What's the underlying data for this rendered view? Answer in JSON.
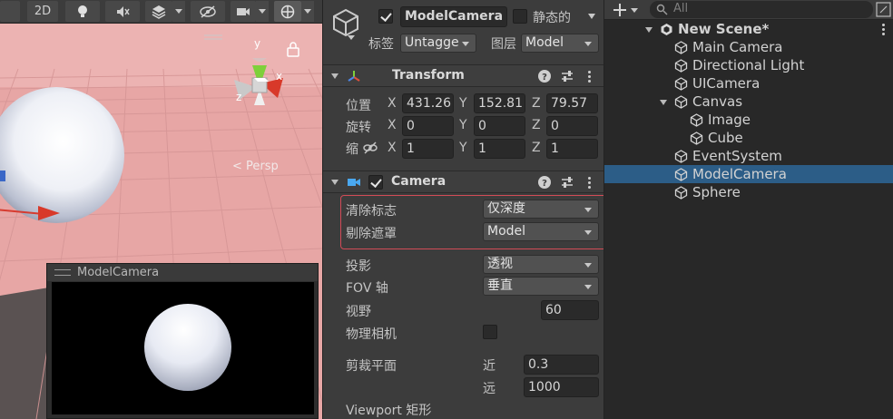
{
  "scene": {
    "toolbar": {
      "mode_2d": "2D"
    },
    "persp_label": "< Persp",
    "gizmo_axis_y": "y",
    "gizmo_axis_x": "x",
    "gizmo_axis_z": "z",
    "preview_title": "ModelCamera"
  },
  "inspector": {
    "object": {
      "active": true,
      "name": "ModelCamera",
      "static_label": "静态的",
      "static": false,
      "tag_label": "标签",
      "tag_value": "Untagge",
      "layer_label": "图层",
      "layer_value": "Model"
    },
    "transform": {
      "title": "Transform",
      "position_label": "位置",
      "rotation_label": "旋转",
      "scale_label": "缩",
      "axes": [
        "X",
        "Y",
        "Z"
      ],
      "position": [
        "431.26",
        "152.81",
        "79.57"
      ],
      "rotation": [
        "0",
        "0",
        "0"
      ],
      "scale": [
        "1",
        "1",
        "1"
      ]
    },
    "camera": {
      "title": "Camera",
      "enabled": true,
      "clear_flags_label": "清除标志",
      "clear_flags_value": "仅深度",
      "culling_mask_label": "剔除遮罩",
      "culling_mask_value": "Model",
      "projection_label": "投影",
      "projection_value": "透视",
      "fov_axis_label": "FOV 轴",
      "fov_axis_value": "垂直",
      "fov_label": "视野",
      "fov_value": "60",
      "physical_label": "物理相机",
      "physical": false,
      "clipping_label": "剪裁平面",
      "near_label": "近",
      "near_value": "0.3",
      "far_label": "远",
      "far_value": "1000",
      "viewport_label": "Viewport 矩形"
    },
    "colors": {
      "highlight": "#d24b57",
      "panel": "#3c3c3c"
    }
  },
  "hierarchy": {
    "search_placeholder": "All",
    "scene_name": "New Scene*",
    "items": [
      {
        "label": "Main Camera",
        "depth": 1,
        "selected": false
      },
      {
        "label": "Directional Light",
        "depth": 1,
        "selected": false
      },
      {
        "label": "UICamera",
        "depth": 1,
        "selected": false
      },
      {
        "label": "Canvas",
        "depth": 1,
        "selected": false,
        "expanded": true
      },
      {
        "label": "Image",
        "depth": 2,
        "selected": false
      },
      {
        "label": "Cube",
        "depth": 2,
        "selected": false
      },
      {
        "label": "EventSystem",
        "depth": 1,
        "selected": false
      },
      {
        "label": "ModelCamera",
        "depth": 1,
        "selected": true
      },
      {
        "label": "Sphere",
        "depth": 1,
        "selected": false
      }
    ],
    "selected_color": "#2c5d87"
  }
}
